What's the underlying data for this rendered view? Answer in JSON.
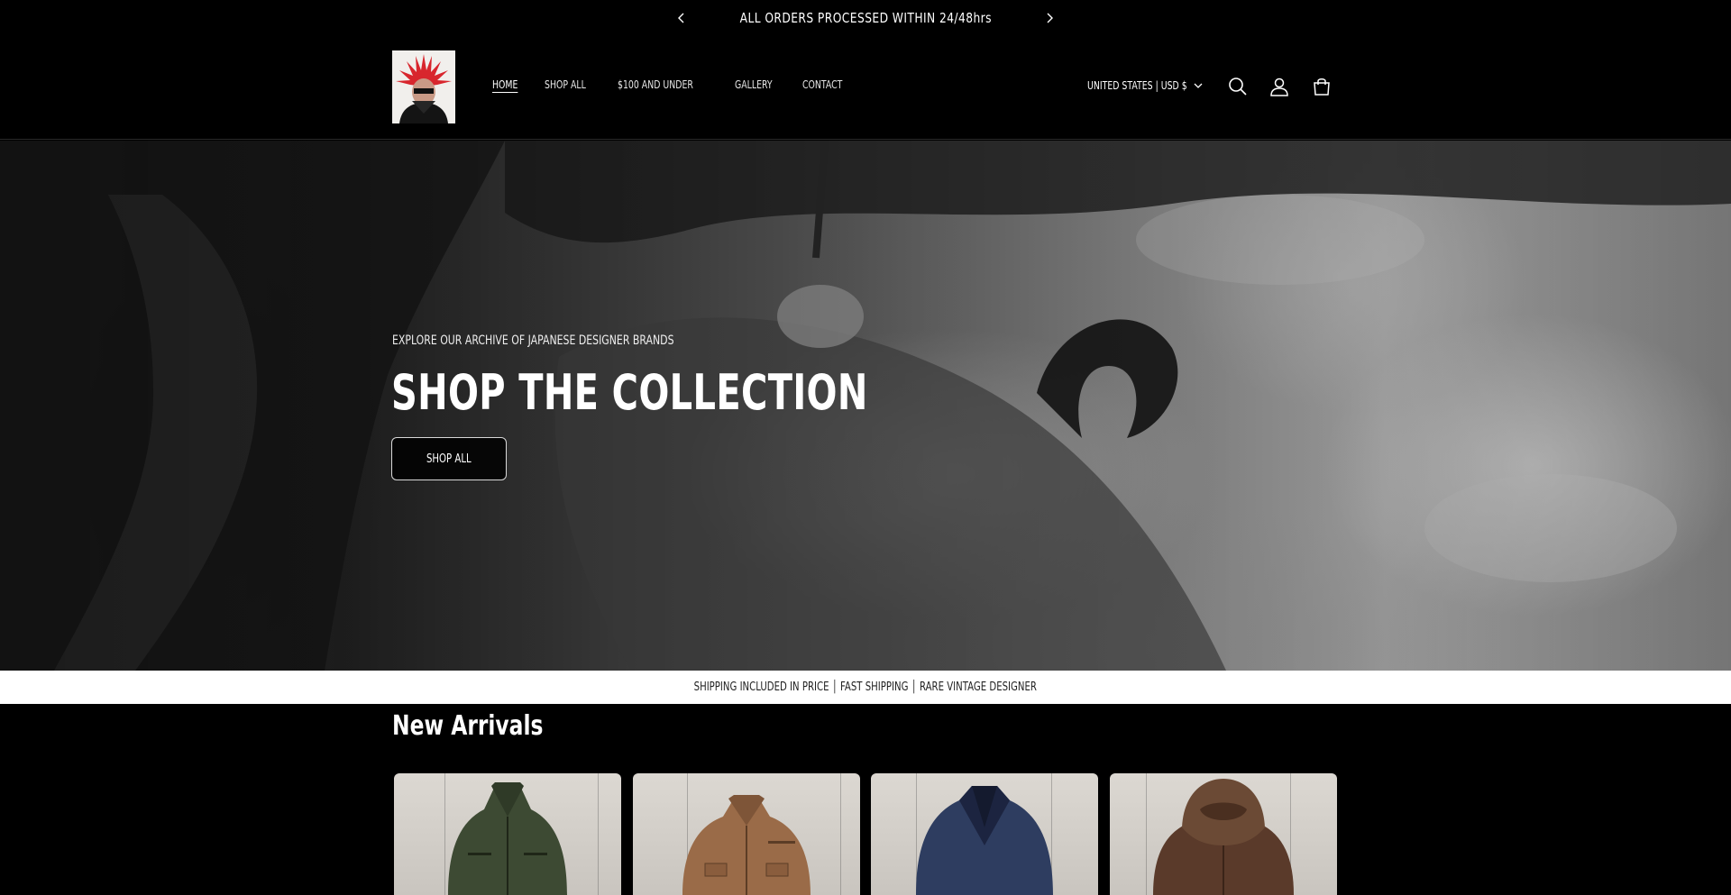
{
  "announcement": {
    "message": "ALL ORDERS PROCESSED WITHIN 24/48hrs"
  },
  "header": {
    "logo_alt": "store logo",
    "nav": [
      {
        "label": "HOME",
        "active": true
      },
      {
        "label": "SHOP ALL",
        "active": false
      },
      {
        "label": "$100 AND UNDER",
        "active": false
      },
      {
        "label": "GALLERY",
        "active": false
      },
      {
        "label": "CONTACT",
        "active": false
      }
    ],
    "country_selector": "UNITED STATES | USD $",
    "icons": [
      "search-icon",
      "account-icon",
      "cart-icon"
    ]
  },
  "hero": {
    "eyebrow": "EXPLORE OUR ARCHIVE OF JAPANESE DESIGNER BRANDS",
    "title": "SHOP THE COLLECTION",
    "button_label": "SHOP ALL"
  },
  "strip": {
    "text": "SHIPPING INCLUDED IN PRICE │ FAST SHIPPING │ RARE VINTAGE DESIGNER"
  },
  "new_arrivals": {
    "title": "New Arrivals",
    "products": [
      {
        "color": "#3d4a33",
        "collar": "#2f3a27",
        "style": "leather-jacket"
      },
      {
        "color": "#9a6b48",
        "collar": "#7e5538",
        "style": "leather-jacket"
      },
      {
        "color": "#2e3d60",
        "collar": "#1c2440",
        "style": "pea-coat"
      },
      {
        "color": "#5a3a2a",
        "collar": "#6b4a35",
        "style": "fur-collar-jacket"
      }
    ]
  }
}
